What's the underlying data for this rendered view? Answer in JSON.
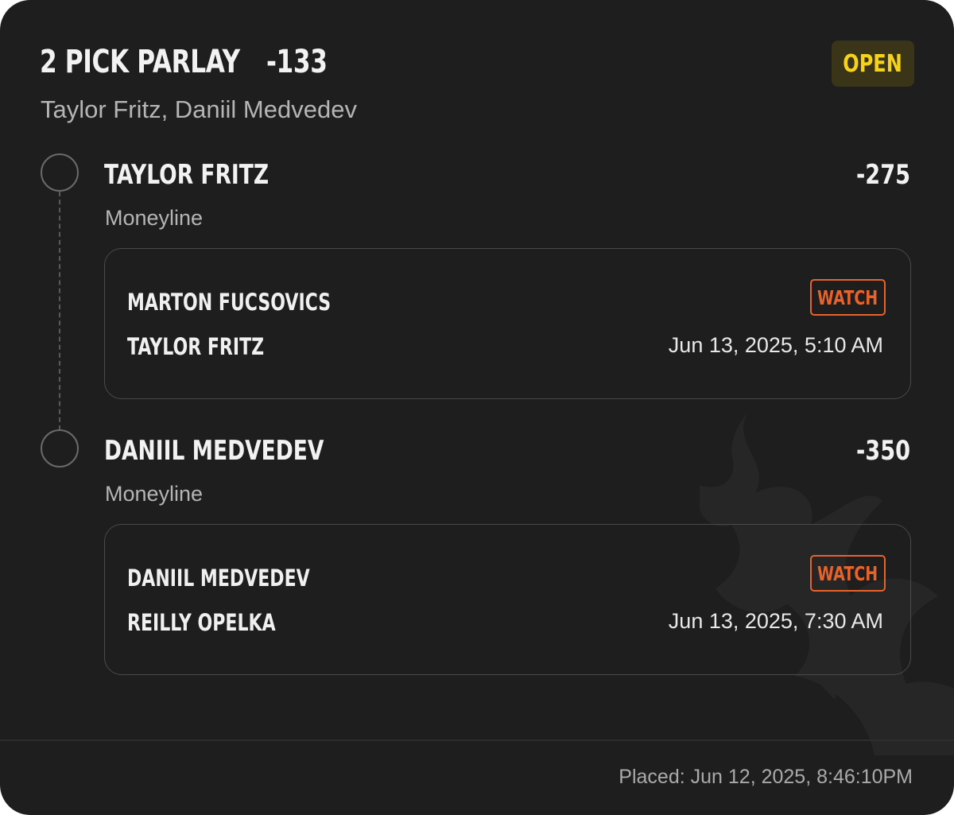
{
  "bet": {
    "title": "2 PICK PARLAY",
    "odds": "-133",
    "subtitle": "Taylor Fritz, Daniil Medvedev",
    "status": "OPEN",
    "status_color": "#f5d31c",
    "accent_color": "#e8622a"
  },
  "legs": [
    {
      "selection": "TAYLOR FRITZ",
      "odds": "-275",
      "market": "Moneyline",
      "match": {
        "player_1": "MARTON FUCSOVICS",
        "player_2": "TAYLOR FRITZ",
        "watch_label": "WATCH",
        "datetime": "Jun 13, 2025, 5:10 AM"
      }
    },
    {
      "selection": "DANIIL MEDVEDEV",
      "odds": "-350",
      "market": "Moneyline",
      "match": {
        "player_1": "DANIIL MEDVEDEV",
        "player_2": "REILLY OPELKA",
        "watch_label": "WATCH",
        "datetime": "Jun 13, 2025, 7:30 AM"
      }
    }
  ],
  "footer": {
    "placed": "Placed: Jun 12, 2025, 8:46:10PM"
  }
}
